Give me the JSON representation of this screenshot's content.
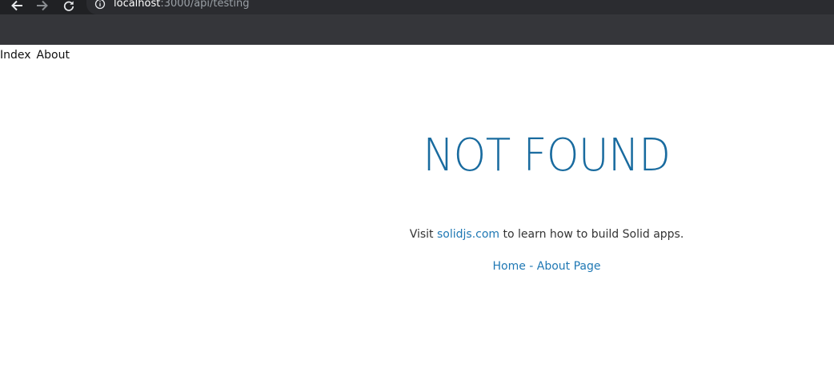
{
  "browser": {
    "url_host": "localhost",
    "url_rest": ":3000/api/testing",
    "icons": [
      "back-arrow-icon",
      "forward-arrow-icon",
      "reload-icon",
      "info-icon"
    ]
  },
  "page_nav": {
    "index_label": "Index",
    "about_label": "About"
  },
  "main": {
    "title": "NOT FOUND",
    "visit_prefix": "Visit ",
    "visit_link": "solidjs.com",
    "visit_suffix": " to learn how to build Solid apps.",
    "home_link": "Home",
    "separator": " - ",
    "about_page_link": "About Page"
  },
  "colors": {
    "title": "#196b9f",
    "link": "#1f78b4",
    "chrome_dark": "#202124",
    "chrome_bar": "#35363a"
  }
}
